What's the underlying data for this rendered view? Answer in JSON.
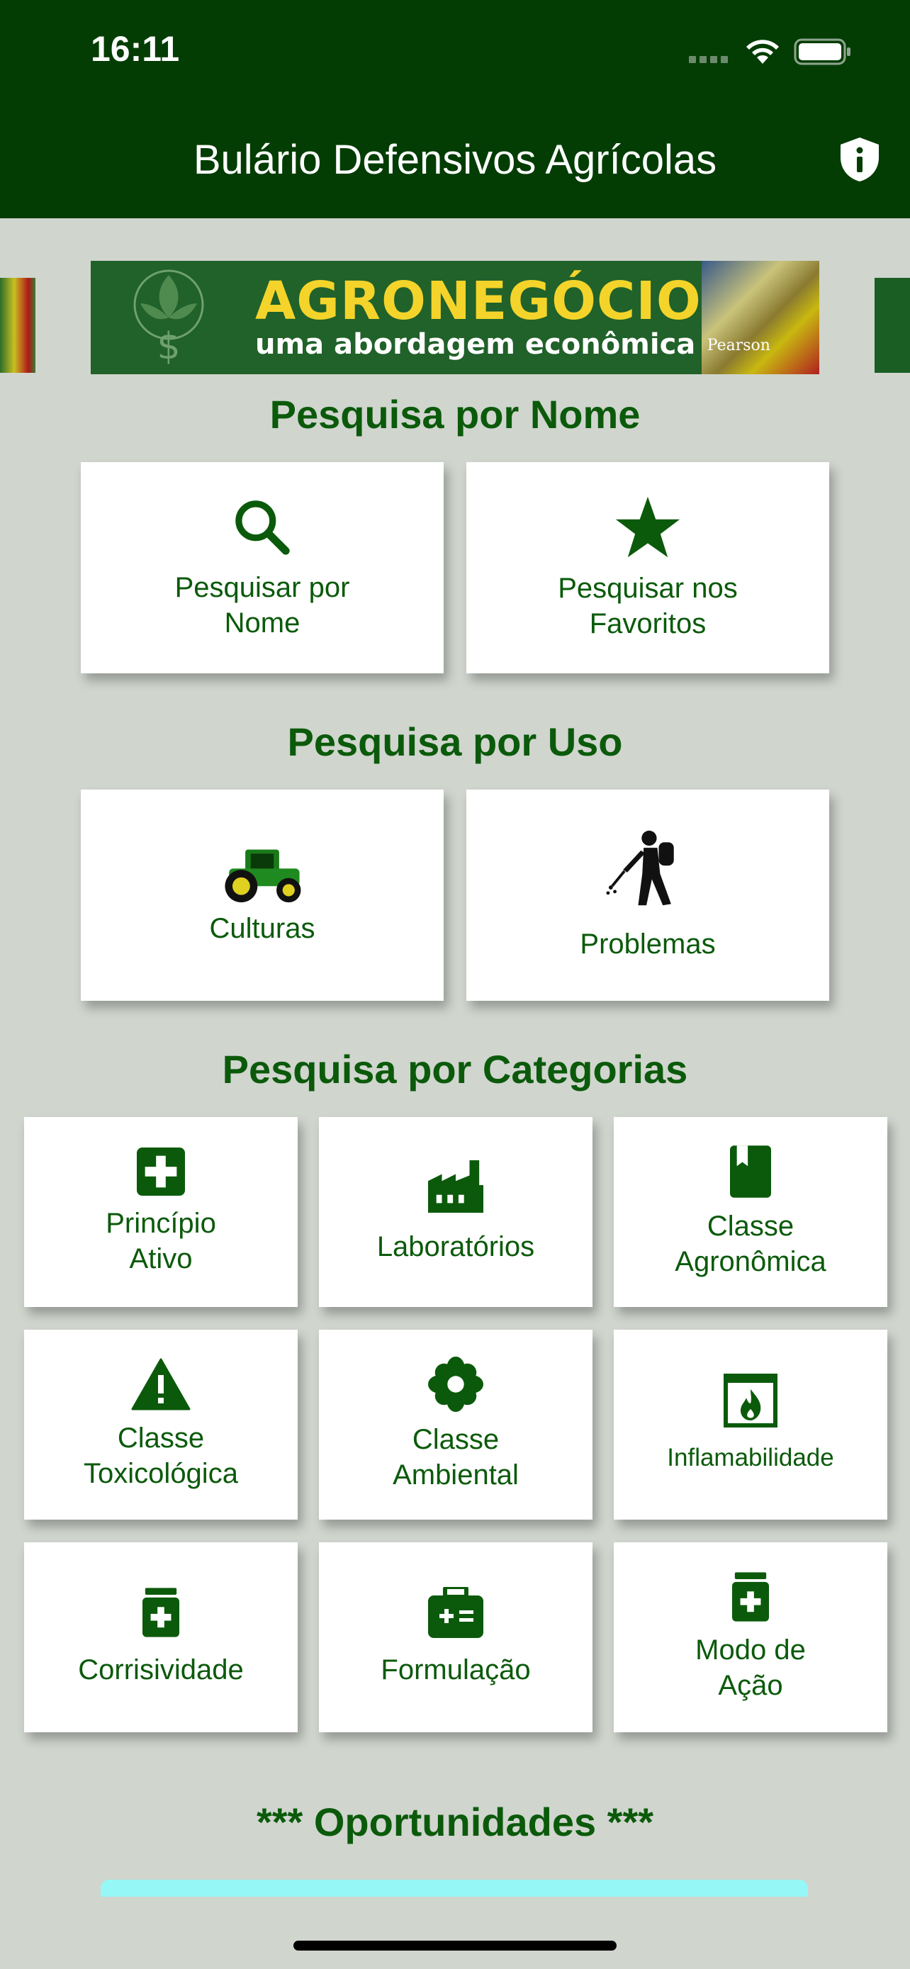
{
  "status_bar": {
    "time": "16:11"
  },
  "nav": {
    "title": "Bulário Defensivos Agrícolas",
    "info_icon": "shield-info-icon"
  },
  "banner": {
    "title": "AGRONEGÓCIO",
    "subtitle": "uma abordagem econômica",
    "publisher": "Pearson"
  },
  "sections": {
    "by_name": "Pesquisa por Nome",
    "by_use": "Pesquisa por Uso",
    "by_category": "Pesquisa por Categorias",
    "opportunities": "*** Oportunidades ***"
  },
  "name_cards": [
    {
      "label": "Pesquisar por\nNome",
      "icon": "search-icon"
    },
    {
      "label": "Pesquisar nos\nFavoritos",
      "icon": "star-icon"
    }
  ],
  "use_cards": [
    {
      "label": "Culturas",
      "icon": "tractor-icon"
    },
    {
      "label": "Problemas",
      "icon": "sprayer-person-icon"
    }
  ],
  "category_cards": [
    {
      "label": "Princípio\nAtivo",
      "icon": "medical-plus-icon"
    },
    {
      "label": "Laboratórios",
      "icon": "factory-icon"
    },
    {
      "label": "Classe\nAgronômica",
      "icon": "book-icon"
    },
    {
      "label": "Classe\nToxicológica",
      "icon": "warning-icon"
    },
    {
      "label": "Classe\nAmbiental",
      "icon": "flower-icon"
    },
    {
      "label": "Inflamabilidade",
      "icon": "fire-icon"
    },
    {
      "label": "Corrisividade",
      "icon": "medicine-bottle-icon"
    },
    {
      "label": "Formulação",
      "icon": "medkit-icon"
    },
    {
      "label": "Modo de\nAção",
      "icon": "prescription-bottle-icon"
    }
  ],
  "colors": {
    "primary_dark": "#043d04",
    "primary_text": "#0b5a0b",
    "background": "#d0d5ce",
    "card": "#ffffff",
    "accent_cyan": "#96f7f7"
  }
}
